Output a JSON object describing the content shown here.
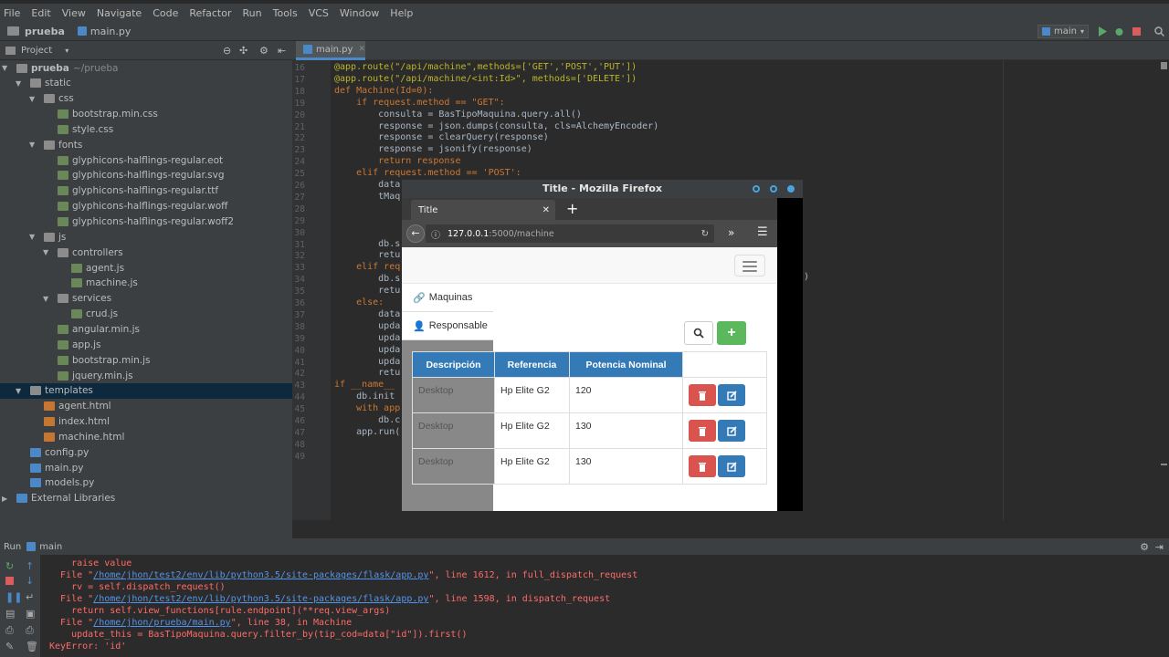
{
  "menu": [
    "File",
    "Edit",
    "View",
    "Navigate",
    "Code",
    "Refactor",
    "Run",
    "Tools",
    "VCS",
    "Window",
    "Help"
  ],
  "breadcrumb": {
    "project": "prueba",
    "file": "main.py"
  },
  "run_config": "main",
  "project_panel": {
    "label": "Project"
  },
  "tree": [
    {
      "label": "prueba",
      "suffix": "~/prueba",
      "depth": 0,
      "kind": "folder",
      "open": true
    },
    {
      "label": "static",
      "depth": 1,
      "kind": "folder",
      "open": true
    },
    {
      "label": "css",
      "depth": 2,
      "kind": "folder",
      "open": true
    },
    {
      "label": "bootstrap.min.css",
      "depth": 3,
      "kind": "css"
    },
    {
      "label": "style.css",
      "depth": 3,
      "kind": "css"
    },
    {
      "label": "fonts",
      "depth": 2,
      "kind": "folder",
      "open": true
    },
    {
      "label": "glyphicons-halflings-regular.eot",
      "depth": 3,
      "kind": "css"
    },
    {
      "label": "glyphicons-halflings-regular.svg",
      "depth": 3,
      "kind": "css"
    },
    {
      "label": "glyphicons-halflings-regular.ttf",
      "depth": 3,
      "kind": "css"
    },
    {
      "label": "glyphicons-halflings-regular.woff",
      "depth": 3,
      "kind": "css"
    },
    {
      "label": "glyphicons-halflings-regular.woff2",
      "depth": 3,
      "kind": "css"
    },
    {
      "label": "js",
      "depth": 2,
      "kind": "folder",
      "open": true
    },
    {
      "label": "controllers",
      "depth": 3,
      "kind": "folder",
      "open": true
    },
    {
      "label": "agent.js",
      "depth": 4,
      "kind": "js"
    },
    {
      "label": "machine.js",
      "depth": 4,
      "kind": "js"
    },
    {
      "label": "services",
      "depth": 3,
      "kind": "folder",
      "open": true
    },
    {
      "label": "crud.js",
      "depth": 4,
      "kind": "js"
    },
    {
      "label": "angular.min.js",
      "depth": 3,
      "kind": "js"
    },
    {
      "label": "app.js",
      "depth": 3,
      "kind": "js"
    },
    {
      "label": "bootstrap.min.js",
      "depth": 3,
      "kind": "js"
    },
    {
      "label": "jquery.min.js",
      "depth": 3,
      "kind": "js"
    },
    {
      "label": "templates",
      "depth": 1,
      "kind": "folder",
      "open": true,
      "selected": true
    },
    {
      "label": "agent.html",
      "depth": 2,
      "kind": "html"
    },
    {
      "label": "index.html",
      "depth": 2,
      "kind": "html"
    },
    {
      "label": "machine.html",
      "depth": 2,
      "kind": "html"
    },
    {
      "label": "config.py",
      "depth": 1,
      "kind": "py"
    },
    {
      "label": "main.py",
      "depth": 1,
      "kind": "py"
    },
    {
      "label": "models.py",
      "depth": 1,
      "kind": "py"
    },
    {
      "label": "External Libraries",
      "depth": 0,
      "kind": "lib"
    }
  ],
  "editor_tab": "main.py",
  "line_numbers": [
    "16",
    "17",
    "18",
    "19",
    "20",
    "21",
    "22",
    "23",
    "24",
    "25",
    "26",
    "27",
    "28",
    "29",
    "30",
    "31",
    "32",
    "33",
    "34",
    "35",
    "36",
    "37",
    "38",
    "39",
    "40",
    "41",
    "42",
    "43",
    "44",
    "45",
    "46",
    "47",
    "48",
    "49"
  ],
  "code_lines": [
    "@app.route(\"/api/machine\",methods=['GET','POST','PUT'])",
    "@app.route(\"/api/machine/<int:Id>\", methods=['DELETE'])",
    "def Machine(Id=0):",
    "    if request.method == \"GET\":",
    "        consulta = BasTipoMaquina.query.all()",
    "        response = json.dumps(consulta, cls=AlchemyEncoder)",
    "        response = clearQuery(response)",
    "        response = jsonify(response)",
    "        return response",
    "    elif request.method == 'POST':",
    "        data",
    "        tMaq",
    "",
    "",
    "",
    "        db.s",
    "        retu",
    "    elif req",
    "        db.s",
    "        retu",
    "    else:",
    "        data",
    "        upda",
    "        upda",
    "        upda",
    "        upda",
    "        retu",
    "if __name__",
    "    db.init",
    "    with app",
    "        db.c",
    "    app.run(",
    "",
    ""
  ],
  "code_frag_right": ")",
  "run_panel": {
    "label": "Run",
    "config": "main"
  },
  "traceback": [
    {
      "text": "  File \"",
      "link": "/home/jhon/test2/env/lib/python3.5/site-packages/flask/app.py",
      "rest": "\", line 1612, in full_dispatch_request"
    },
    {
      "text": "    rv = self.dispatch_request()"
    },
    {
      "text": "  File \"",
      "link": "/home/jhon/test2/env/lib/python3.5/site-packages/flask/app.py",
      "rest": "\", line 1598, in dispatch_request"
    },
    {
      "text": "    return self.view_functions[rule.endpoint](**req.view_args)"
    },
    {
      "text": "  File \"",
      "link": "/home/jhon/prueba/main.py",
      "rest": "\", line 38, in Machine"
    },
    {
      "text": "    update_this = BasTipoMaquina.query.filter_by(tip_cod=data[\"id\"]).first()"
    },
    {
      "text": "KeyError: 'id'"
    }
  ],
  "traceback_top": [
    "    raise value"
  ],
  "firefox": {
    "title": "Title - Mozilla Firefox",
    "tab_title": "Title",
    "url_host": "127.0.0.1",
    "url_path": ":5000/machine"
  },
  "webapp": {
    "sidebar": [
      "Maquinas",
      "Responsable"
    ],
    "columns": [
      "Descripción",
      "Referencia",
      "Potencia Nominal"
    ],
    "rows": [
      [
        "Desktop",
        "Hp Elite G2",
        "120"
      ],
      [
        "Desktop",
        "Hp Elite G2",
        "130"
      ],
      [
        "Desktop",
        "Hp Elite G2",
        "130"
      ]
    ]
  },
  "colors": {
    "accent": "#4a88c7",
    "success": "#5cb85c",
    "danger": "#d9534f",
    "primary": "#337ab7"
  }
}
